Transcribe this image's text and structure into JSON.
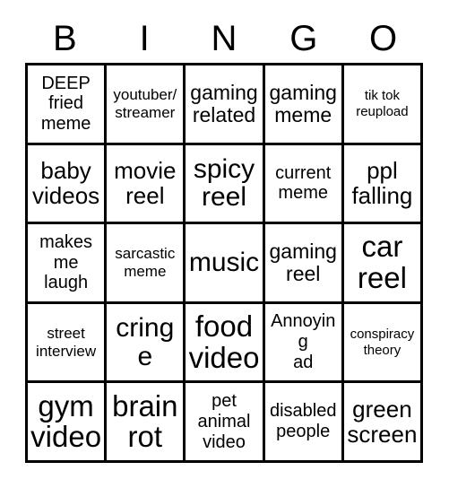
{
  "card": {
    "title": "BINGO",
    "headers": [
      "B",
      "I",
      "N",
      "G",
      "O"
    ],
    "colors": {
      "background": "#ffffff",
      "text": "#000000",
      "grid_line": "#000000"
    },
    "rows": [
      {
        "cells": [
          {
            "text": "DEEP\nfried\nmeme",
            "size": "fs-md",
            "lines": 3
          },
          {
            "text": "youtuber/\nstreamer",
            "size": "fs-sm",
            "lines": 2
          },
          {
            "text": "gaming\nrelated",
            "size": "fs-lg",
            "lines": 2
          },
          {
            "text": "gaming\nmeme",
            "size": "fs-lg",
            "lines": 2
          },
          {
            "text": "tik tok\nreupload",
            "size": "fs-xs",
            "lines": 2
          }
        ]
      },
      {
        "cells": [
          {
            "text": "baby\nvideos",
            "size": "fs-xl",
            "lines": 2
          },
          {
            "text": "movie\nreel",
            "size": "fs-xl",
            "lines": 2
          },
          {
            "text": "spicy\nreel",
            "size": "fs-xxl",
            "lines": 2
          },
          {
            "text": "current\nmeme",
            "size": "fs-md",
            "lines": 2
          },
          {
            "text": "ppl\nfalling",
            "size": "fs-xl",
            "lines": 2
          }
        ]
      },
      {
        "cells": [
          {
            "text": "makes\nme\nlaugh",
            "size": "fs-md",
            "lines": 3
          },
          {
            "text": "sarcastic\nmeme",
            "size": "fs-sm",
            "lines": 2
          },
          {
            "text": "music",
            "size": "fs-xxl",
            "lines": 1
          },
          {
            "text": "gaming\nreel",
            "size": "fs-lg",
            "lines": 2
          },
          {
            "text": "car\nreel",
            "size": "fs-huge",
            "lines": 2
          }
        ]
      },
      {
        "cells": [
          {
            "text": "street\ninterview",
            "size": "fs-sm",
            "lines": 2
          },
          {
            "text": "cringe",
            "size": "fs-xxl",
            "lines": 1
          },
          {
            "text": "food\nvideo",
            "size": "fs-huge",
            "lines": 2
          },
          {
            "text": "Annoying\nad",
            "size": "fs-md",
            "lines": 2
          },
          {
            "text": "conspiracy\ntheory",
            "size": "fs-xs",
            "lines": 2
          }
        ]
      },
      {
        "cells": [
          {
            "text": "gym\nvideo",
            "size": "fs-huge",
            "lines": 2
          },
          {
            "text": "brain\nrot",
            "size": "fs-huge",
            "lines": 2
          },
          {
            "text": "pet\nanimal\nvideo",
            "size": "fs-md",
            "lines": 3
          },
          {
            "text": "disabled\npeople",
            "size": "fs-md",
            "lines": 2
          },
          {
            "text": "green\nscreen",
            "size": "fs-xl",
            "lines": 2
          }
        ]
      }
    ]
  }
}
